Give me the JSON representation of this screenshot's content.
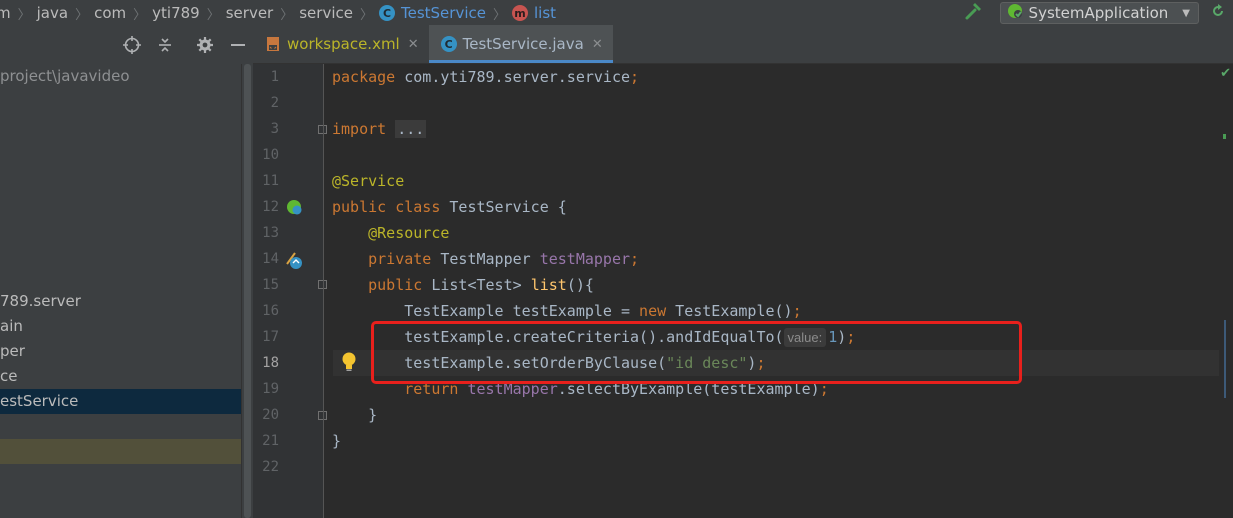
{
  "breadcrumbs": {
    "items": [
      "m",
      "java",
      "com",
      "yti789",
      "server",
      "service",
      "TestService",
      "list"
    ]
  },
  "run_config": {
    "label": "SystemApplication"
  },
  "sidebar": {
    "path_label": "project\\javavideo",
    "tree": [
      {
        "label": "789.server",
        "state": "normal"
      },
      {
        "label": "ain",
        "state": "normal"
      },
      {
        "label": "per",
        "state": "normal"
      },
      {
        "label": "ce",
        "state": "normal"
      },
      {
        "label": "estService",
        "state": "selected"
      },
      {
        "label": "",
        "state": "normal"
      },
      {
        "label": "",
        "state": "highlight"
      }
    ]
  },
  "tabs": [
    {
      "label": "workspace.xml",
      "active": false
    },
    {
      "label": "TestService.java",
      "active": true
    }
  ],
  "editor": {
    "current_line": "18",
    "line_numbers": [
      "1",
      "2",
      "3",
      "10",
      "11",
      "12",
      "13",
      "14",
      "15",
      "16",
      "17",
      "18",
      "19",
      "20",
      "21",
      "22"
    ],
    "lines": [
      [
        {
          "t": "package ",
          "c": "kw"
        },
        {
          "t": "com.yti789.server.service",
          "c": ""
        },
        {
          "t": ";",
          "c": "kw"
        }
      ],
      [],
      [
        {
          "t": "import ",
          "c": "kw"
        },
        {
          "t": "...",
          "c": "fold"
        }
      ],
      [],
      [
        {
          "t": "@Service",
          "c": "ann"
        }
      ],
      [
        {
          "t": "public class ",
          "c": "kw"
        },
        {
          "t": "TestService {",
          "c": ""
        }
      ],
      [
        {
          "t": "    ",
          "c": ""
        },
        {
          "t": "@Resource",
          "c": "ann"
        }
      ],
      [
        {
          "t": "    ",
          "c": ""
        },
        {
          "t": "private ",
          "c": "kw"
        },
        {
          "t": "TestMapper ",
          "c": ""
        },
        {
          "t": "testMapper",
          "c": "fld"
        },
        {
          "t": ";",
          "c": "kw"
        }
      ],
      [
        {
          "t": "    ",
          "c": ""
        },
        {
          "t": "public ",
          "c": "kw"
        },
        {
          "t": "List<Test> ",
          "c": ""
        },
        {
          "t": "list",
          "c": "mth"
        },
        {
          "t": "(){",
          "c": ""
        }
      ],
      [
        {
          "t": "        TestExample testExample = ",
          "c": ""
        },
        {
          "t": "new ",
          "c": "kw"
        },
        {
          "t": "TestExample()",
          "c": ""
        },
        {
          "t": ";",
          "c": "kw"
        }
      ],
      [
        {
          "t": "        testExample.createCriteria().andIdEqualTo(",
          "c": ""
        },
        {
          "t": "value:",
          "c": "hint"
        },
        {
          "t": "1",
          "c": "num"
        },
        {
          "t": ")",
          "c": ""
        },
        {
          "t": ";",
          "c": "kw"
        }
      ],
      [
        {
          "t": "        testExample.setOrderByClause(",
          "c": ""
        },
        {
          "t": "\"id desc\"",
          "c": "str"
        },
        {
          "t": ")",
          "c": ""
        },
        {
          "t": ";",
          "c": "kw"
        }
      ],
      [
        {
          "t": "        ",
          "c": ""
        },
        {
          "t": "return ",
          "c": "kw"
        },
        {
          "t": "testMapper",
          "c": "fld"
        },
        {
          "t": ".selectByExample(testExample)",
          "c": ""
        },
        {
          "t": ";",
          "c": "kw"
        }
      ],
      [
        {
          "t": "    }",
          "c": ""
        }
      ],
      [
        {
          "t": "}",
          "c": ""
        }
      ],
      []
    ]
  }
}
